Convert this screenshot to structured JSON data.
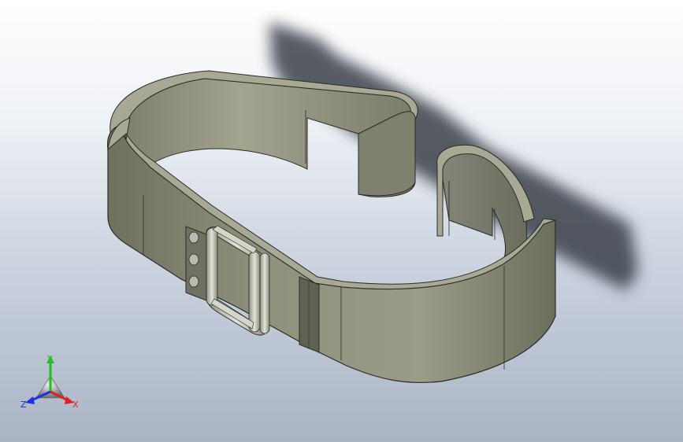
{
  "viewport": {
    "background_top": "#ffffff",
    "background_bottom": "#aab4c4"
  },
  "model": {
    "part": "belt",
    "body_color": "#8d8f7c",
    "body_dark": "#5f6153",
    "body_light": "#a7a994",
    "edge_color": "#2b2c26",
    "shadow_color": "#3a3f48",
    "buckle_color": "#b9bbae"
  },
  "triad": {
    "x_label": "X",
    "y_label": "Y",
    "z_label": "Z",
    "x_color": "#e02020",
    "y_color": "#20c020",
    "z_color": "#2030e0"
  }
}
